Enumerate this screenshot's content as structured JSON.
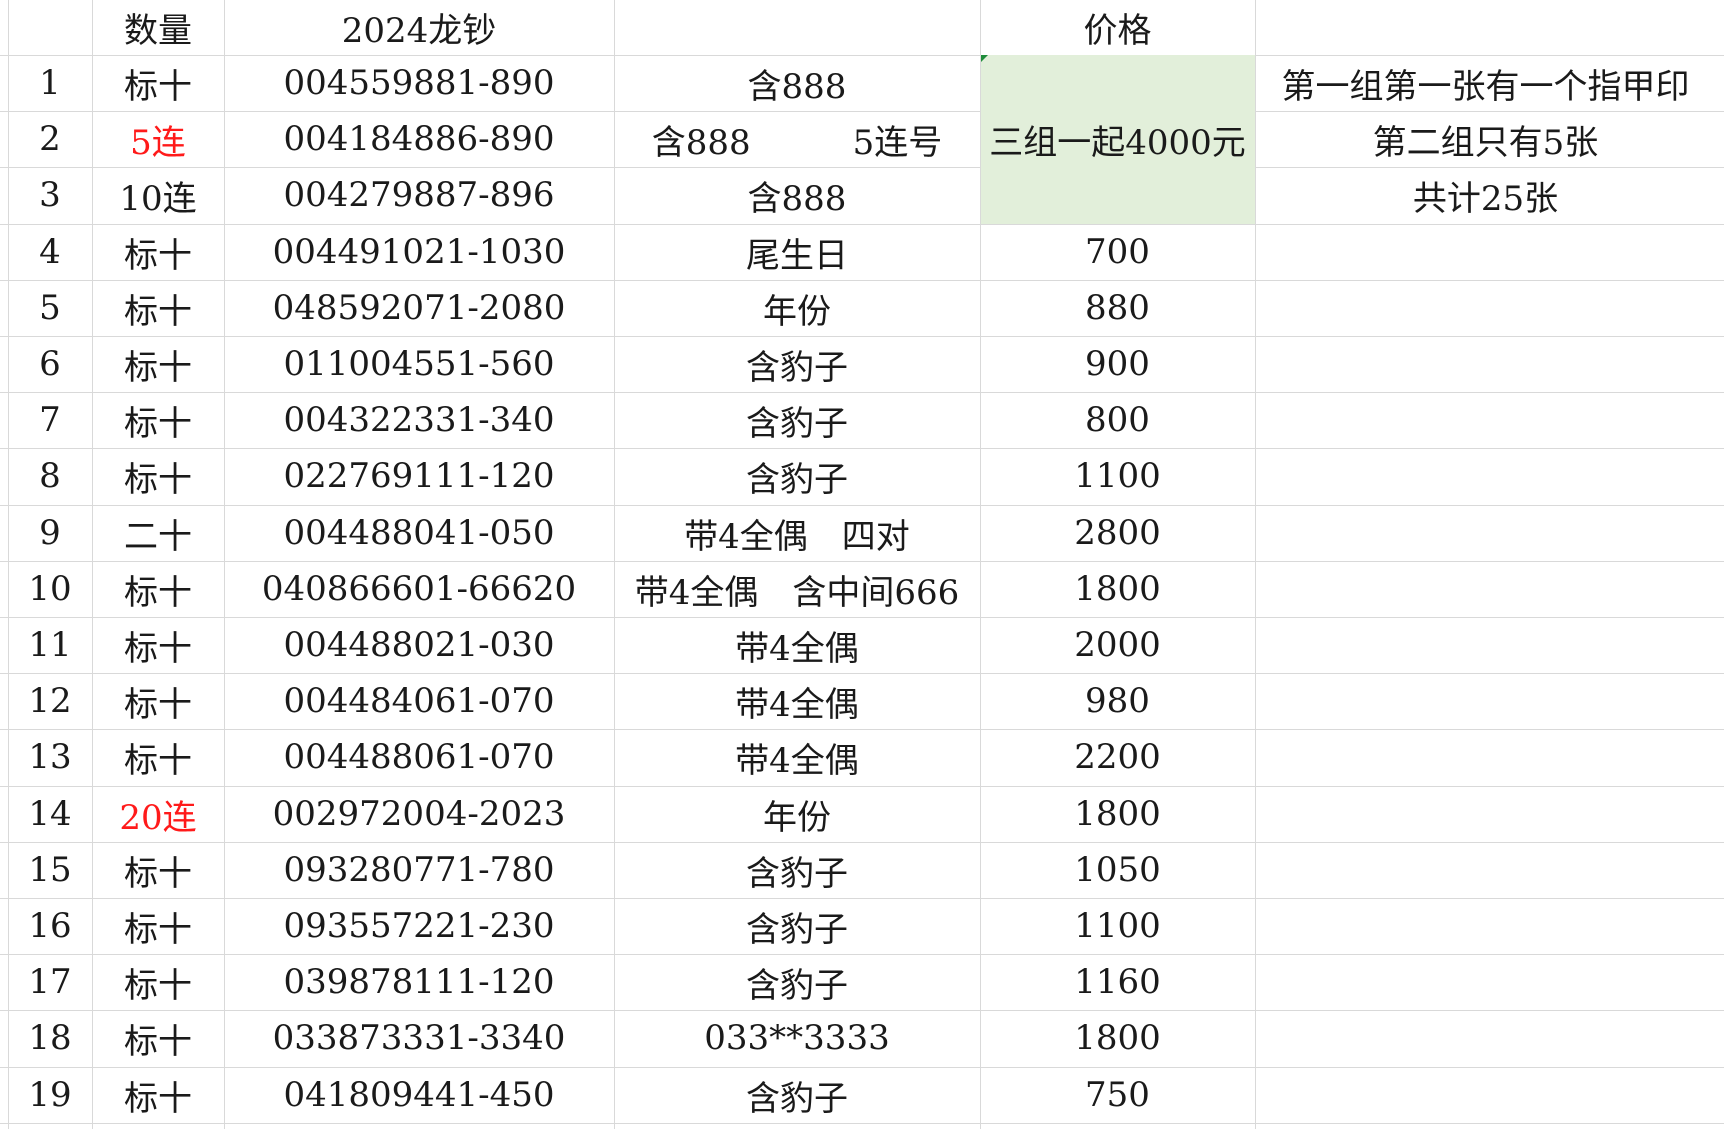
{
  "header": {
    "quantity": "数量",
    "series": "2024龙钞",
    "note": "",
    "price": "价格"
  },
  "colors": {
    "red_text": "#ff1a1a",
    "price_merged_fill": "#e2efda",
    "gridline": "#d9d9d9"
  },
  "merged_price": "三组一起4000元",
  "side_notes": [
    "第一组第一张有一个指甲印",
    "第二组只有5张",
    "共计25张"
  ],
  "rows": [
    {
      "idx": "1",
      "qty": "标十",
      "qty_red": false,
      "serial": "004559881-890",
      "note": "含888",
      "price": ""
    },
    {
      "idx": "2",
      "qty": "5连",
      "qty_red": true,
      "serial": "004184886-890",
      "note": "含888　　　5连号",
      "price": ""
    },
    {
      "idx": "3",
      "qty": "10连",
      "qty_red": false,
      "serial": "004279887-896",
      "note": "含888",
      "price": ""
    },
    {
      "idx": "4",
      "qty": "标十",
      "qty_red": false,
      "serial": "004491021-1030",
      "note": "尾生日",
      "price": "700"
    },
    {
      "idx": "5",
      "qty": "标十",
      "qty_red": false,
      "serial": "048592071-2080",
      "note": "年份",
      "price": "880"
    },
    {
      "idx": "6",
      "qty": "标十",
      "qty_red": false,
      "serial": "011004551-560",
      "note": "含豹子",
      "price": "900"
    },
    {
      "idx": "7",
      "qty": "标十",
      "qty_red": false,
      "serial": "004322331-340",
      "note": "含豹子",
      "price": "800"
    },
    {
      "idx": "8",
      "qty": "标十",
      "qty_red": false,
      "serial": "022769111-120",
      "note": "含豹子",
      "price": "1100"
    },
    {
      "idx": "9",
      "qty": "二十",
      "qty_red": false,
      "serial": "004488041-050",
      "note": "带4全偶　四对",
      "price": "2800"
    },
    {
      "idx": "10",
      "qty": "标十",
      "qty_red": false,
      "serial": "040866601-66620",
      "note": "带4全偶　含中间666",
      "price": "1800"
    },
    {
      "idx": "11",
      "qty": "标十",
      "qty_red": false,
      "serial": "004488021-030",
      "note": "带4全偶",
      "price": "2000"
    },
    {
      "idx": "12",
      "qty": "标十",
      "qty_red": false,
      "serial": "004484061-070",
      "note": "带4全偶",
      "price": "980"
    },
    {
      "idx": "13",
      "qty": "标十",
      "qty_red": false,
      "serial": "004488061-070",
      "note": "带4全偶",
      "price": "2200"
    },
    {
      "idx": "14",
      "qty": "20连",
      "qty_red": true,
      "serial": "002972004-2023",
      "note": "年份",
      "price": "1800"
    },
    {
      "idx": "15",
      "qty": "标十",
      "qty_red": false,
      "serial": "093280771-780",
      "note": "含豹子",
      "price": "1050"
    },
    {
      "idx": "16",
      "qty": "标十",
      "qty_red": false,
      "serial": "093557221-230",
      "note": "含豹子",
      "price": "1100"
    },
    {
      "idx": "17",
      "qty": "标十",
      "qty_red": false,
      "serial": "039878111-120",
      "note": "含豹子",
      "price": "1160"
    },
    {
      "idx": "18",
      "qty": "标十",
      "qty_red": false,
      "serial": "033873331-3340",
      "note": "033**3333",
      "price": "1800"
    },
    {
      "idx": "19",
      "qty": "标十",
      "qty_red": false,
      "serial": "041809441-450",
      "note": "含豹子",
      "price": "750"
    }
  ]
}
